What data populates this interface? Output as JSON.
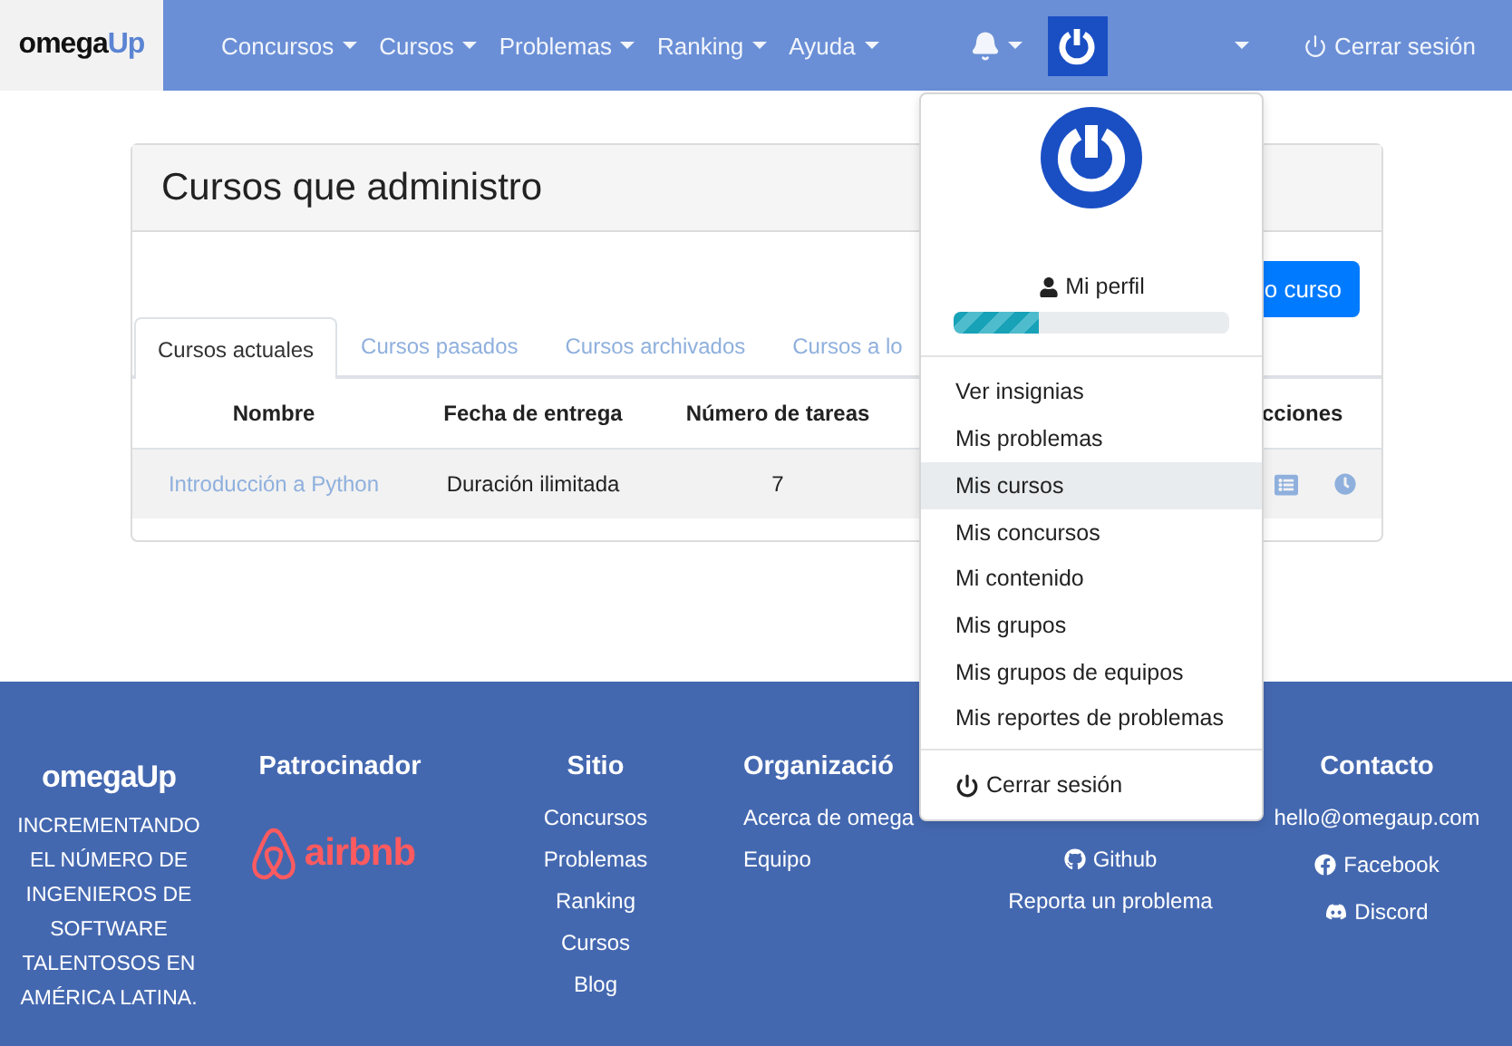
{
  "header": {
    "logo": {
      "part_1": "omega",
      "part_2": "Up"
    },
    "nav": [
      "Concursos",
      "Cursos",
      "Problemas",
      "Ranking",
      "Ayuda"
    ],
    "logout": "Cerrar sesión"
  },
  "card": {
    "title": "Cursos que administro",
    "new_button": "o curso",
    "tabs": [
      {
        "label": "Cursos actuales",
        "selected": true
      },
      {
        "label": "Cursos pasados",
        "selected": false
      },
      {
        "label": "Cursos archivados",
        "selected": false
      },
      {
        "label": "Cursos a lo",
        "selected": false
      }
    ],
    "table": {
      "columns": [
        "Nombre",
        "Fecha de entrega",
        "Número de tareas",
        "cciones"
      ],
      "rows": [
        {
          "name": "Introducción a Python",
          "due": "Duración ilimitada",
          "tasks": "7"
        }
      ]
    }
  },
  "user_menu": {
    "profile": "Mi perfil",
    "level": 0.31,
    "items": [
      {
        "label": "Ver insignias",
        "selected": false
      },
      {
        "label": "Mis problemas",
        "selected": false
      },
      {
        "label": "Mis cursos",
        "selected": true
      },
      {
        "label": "Mis concursos",
        "selected": false
      },
      {
        "label": "Mi contenido",
        "selected": false
      },
      {
        "label": "Mis grupos",
        "selected": false
      },
      {
        "label": "Mis grupos de equipos",
        "selected": false
      },
      {
        "label": "Mis reportes de problemas",
        "selected": false
      }
    ],
    "logout": "Cerrar sesión"
  },
  "footer": {
    "brand": "omegaUp",
    "tagline": "INCREMENTANDO EL NÚMERO DE INGENIEROS DE SOFTWARE TALENTOSOS EN AMÉRICA LATINA.",
    "sponsor": {
      "heading": "Patrocinador",
      "logo_text": "airbnb"
    },
    "site": {
      "heading": "Sitio",
      "links": [
        "Concursos",
        "Problemas",
        "Ranking",
        "Cursos",
        "Blog"
      ]
    },
    "organization": {
      "heading": "Organizació",
      "links": [
        "Acerca de omega",
        "Equipo"
      ]
    },
    "more": {
      "links": [
        {
          "kind": "github",
          "label": "Github"
        },
        {
          "kind": "plain",
          "label": "Reporta un problema"
        }
      ]
    },
    "contact": {
      "heading": "Contacto",
      "links": [
        {
          "kind": "plain",
          "label": "hello@omegaup.com"
        },
        {
          "kind": "facebook",
          "label": "Facebook"
        },
        {
          "kind": "discord",
          "label": "Discord"
        }
      ]
    }
  }
}
